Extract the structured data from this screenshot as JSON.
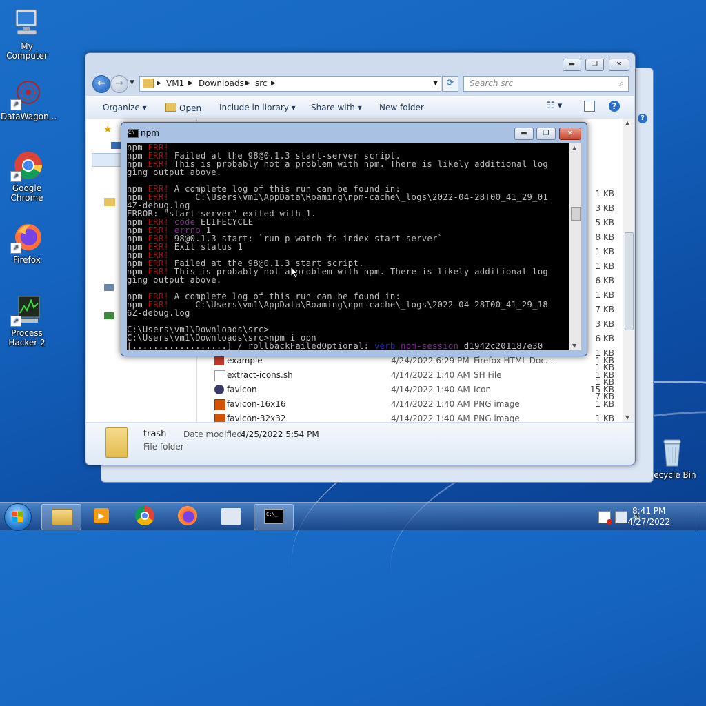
{
  "desktop": {
    "icons": [
      {
        "label": "My Computer"
      },
      {
        "label": "DataWagon..."
      },
      {
        "label": "Google Chrome"
      },
      {
        "label": "Firefox"
      },
      {
        "label": "Process Hacker 2"
      },
      {
        "label": "Recycle Bin"
      }
    ]
  },
  "explorer": {
    "breadcrumb": [
      "VM1",
      "Downloads",
      "src"
    ],
    "search_placeholder": "Search src",
    "commands": {
      "organize": "Organize",
      "open": "Open",
      "include": "Include in library",
      "share": "Share with",
      "new_folder": "New folder"
    },
    "hidden_sizes": [
      "1 KB",
      "3 KB",
      "5 KB",
      "8 KB",
      "1 KB",
      "1 KB",
      "6 KB",
      "1 KB",
      "7 KB",
      "3 KB",
      "6 KB",
      "1 KB",
      "1 KB",
      "1 KB",
      "7 KB"
    ],
    "files": [
      {
        "name": "example",
        "date": "4/24/2022 6:29 PM",
        "type": "Firefox HTML Doc...",
        "size": "1 KB"
      },
      {
        "name": "extract-icons.sh",
        "date": "4/14/2022 1:40 AM",
        "type": "SH File",
        "size": "1 KB"
      },
      {
        "name": "favicon",
        "date": "4/14/2022 1:40 AM",
        "type": "Icon",
        "size": "15 KB"
      },
      {
        "name": "favicon-16x16",
        "date": "4/14/2022 1:40 AM",
        "type": "PNG image",
        "size": "1 KB"
      },
      {
        "name": "favicon-32x32",
        "date": "4/14/2022 1:40 AM",
        "type": "PNG image",
        "size": "1 KB"
      }
    ],
    "details": {
      "name": "trash",
      "modified_label": "Date modified:",
      "modified_value": "4/25/2022 5:54 PM",
      "type": "File folder"
    }
  },
  "console": {
    "title": "npm",
    "lines": [
      [
        {
          "t": "npm "
        },
        {
          "t": "ERR!",
          "c": "red"
        }
      ],
      [
        {
          "t": "npm "
        },
        {
          "t": "ERR!",
          "c": "red"
        },
        {
          "t": " Failed at the 98@0.1.3 start-server script."
        }
      ],
      [
        {
          "t": "npm "
        },
        {
          "t": "ERR!",
          "c": "red"
        },
        {
          "t": " This is probably not a problem with npm. There is likely additional log"
        }
      ],
      [
        {
          "t": "ging output above."
        }
      ],
      [
        {
          "t": ""
        }
      ],
      [
        {
          "t": "npm "
        },
        {
          "t": "ERR!",
          "c": "red"
        },
        {
          "t": " A complete log of this run can be found in:"
        }
      ],
      [
        {
          "t": "npm "
        },
        {
          "t": "ERR!",
          "c": "red"
        },
        {
          "t": "     C:\\Users\\vm1\\AppData\\Roaming\\npm-cache\\_logs\\2022-04-28T00_41_29_01"
        }
      ],
      [
        {
          "t": "4Z-debug.log"
        }
      ],
      [
        {
          "t": "ERROR: \"start-server\" exited with 1."
        }
      ],
      [
        {
          "t": "npm "
        },
        {
          "t": "ERR!",
          "c": "red"
        },
        {
          "t": " "
        },
        {
          "t": "code",
          "c": "purple"
        },
        {
          "t": " ELIFECYCLE"
        }
      ],
      [
        {
          "t": "npm "
        },
        {
          "t": "ERR!",
          "c": "red"
        },
        {
          "t": " "
        },
        {
          "t": "errno",
          "c": "purple"
        },
        {
          "t": " 1"
        }
      ],
      [
        {
          "t": "npm "
        },
        {
          "t": "ERR!",
          "c": "red"
        },
        {
          "t": " 98@0.1.3 start: `run-p watch-fs-index start-server`"
        }
      ],
      [
        {
          "t": "npm "
        },
        {
          "t": "ERR!",
          "c": "red"
        },
        {
          "t": " Exit status 1"
        }
      ],
      [
        {
          "t": "npm "
        },
        {
          "t": "ERR!",
          "c": "red"
        }
      ],
      [
        {
          "t": "npm "
        },
        {
          "t": "ERR!",
          "c": "red"
        },
        {
          "t": " Failed at the 98@0.1.3 start script."
        }
      ],
      [
        {
          "t": "npm "
        },
        {
          "t": "ERR!",
          "c": "red"
        },
        {
          "t": " This is probably not a problem with npm. There is likely additional log"
        }
      ],
      [
        {
          "t": "ging output above."
        }
      ],
      [
        {
          "t": ""
        }
      ],
      [
        {
          "t": "npm "
        },
        {
          "t": "ERR!",
          "c": "red"
        },
        {
          "t": " A complete log of this run can be found in:"
        }
      ],
      [
        {
          "t": "npm "
        },
        {
          "t": "ERR!",
          "c": "red"
        },
        {
          "t": "     C:\\Users\\vm1\\AppData\\Roaming\\npm-cache\\_logs\\2022-04-28T00_41_29_18"
        }
      ],
      [
        {
          "t": "6Z-debug.log"
        }
      ],
      [
        {
          "t": ""
        }
      ],
      [
        {
          "t": "C:\\Users\\vm1\\Downloads\\src>"
        }
      ],
      [
        {
          "t": "C:\\Users\\vm1\\Downloads\\src>npm i opn"
        }
      ],
      [
        {
          "t": "[..................] / rollbackFailedOptional: "
        },
        {
          "t": "verb",
          "c": "blue"
        },
        {
          "t": " "
        },
        {
          "t": "npm-session",
          "c": "purple"
        },
        {
          "t": " d1942c201187e30"
        }
      ]
    ]
  },
  "taskbar": {
    "time": "8:41 PM",
    "date": "4/27/2022"
  }
}
